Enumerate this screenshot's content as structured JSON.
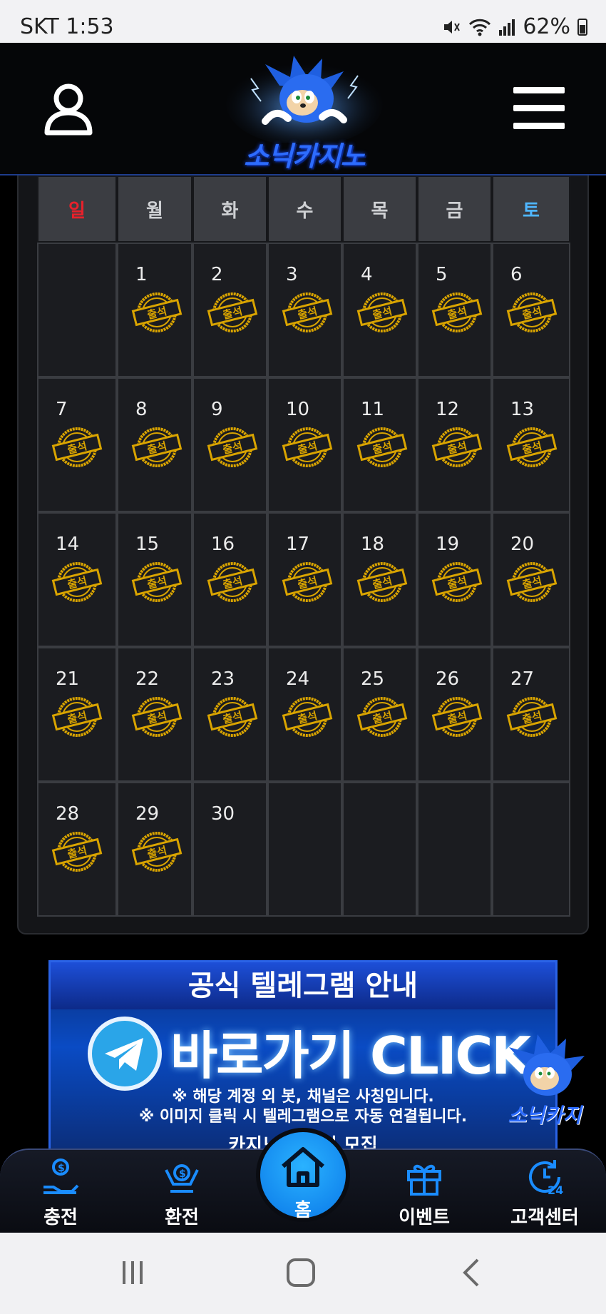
{
  "status_bar": {
    "time": "SKT 1:53",
    "battery": "62%",
    "icons": [
      "mute-icon",
      "wifi-icon",
      "signal-icon",
      "battery-icon"
    ]
  },
  "header": {
    "logo_text": "소닉카지노"
  },
  "calendar": {
    "weekdays": [
      "일",
      "월",
      "화",
      "수",
      "목",
      "금",
      "토"
    ],
    "weekday_colors": {
      "sunday": "#e8212b",
      "weekday": "#cfd1d4",
      "saturday": "#4fb6ff"
    },
    "stamp_label": "출석",
    "weeks": [
      [
        null,
        "1",
        "2",
        "3",
        "4",
        "5",
        "6"
      ],
      [
        "7",
        "8",
        "9",
        "10",
        "11",
        "12",
        "13"
      ],
      [
        "14",
        "15",
        "16",
        "17",
        "18",
        "19",
        "20"
      ],
      [
        "21",
        "22",
        "23",
        "24",
        "25",
        "26",
        "27"
      ],
      [
        "28",
        "29",
        "30",
        null,
        null,
        null,
        null
      ]
    ],
    "attended_days": [
      1,
      2,
      3,
      4,
      5,
      6,
      7,
      8,
      9,
      10,
      11,
      12,
      13,
      14,
      15,
      16,
      17,
      18,
      19,
      20,
      21,
      22,
      23,
      24,
      25,
      26,
      27,
      28,
      29
    ]
  },
  "banner": {
    "title": "공식 텔레그램 안내",
    "cta": "바로가기 CLICK",
    "notice1": "※ 해당 계정 외 봇, 채널은 사칭입니다.",
    "notice2": "※ 이미지 클릭 시 텔레그램으로 자동 연결됩니다.",
    "notice3": "카지노 파트너 모집",
    "mascot_text": "소닉카지"
  },
  "bottom_nav": {
    "items": [
      {
        "label": "충전",
        "icon": "deposit-icon"
      },
      {
        "label": "환전",
        "icon": "withdraw-icon"
      },
      {
        "label": "홈",
        "icon": "home-icon"
      },
      {
        "label": "이벤트",
        "icon": "gift-icon"
      },
      {
        "label": "고객센터",
        "icon": "support-24-icon"
      }
    ]
  },
  "colors": {
    "accent": "#0a8cf0",
    "gold": "#d9a400",
    "bg": "#000000"
  }
}
